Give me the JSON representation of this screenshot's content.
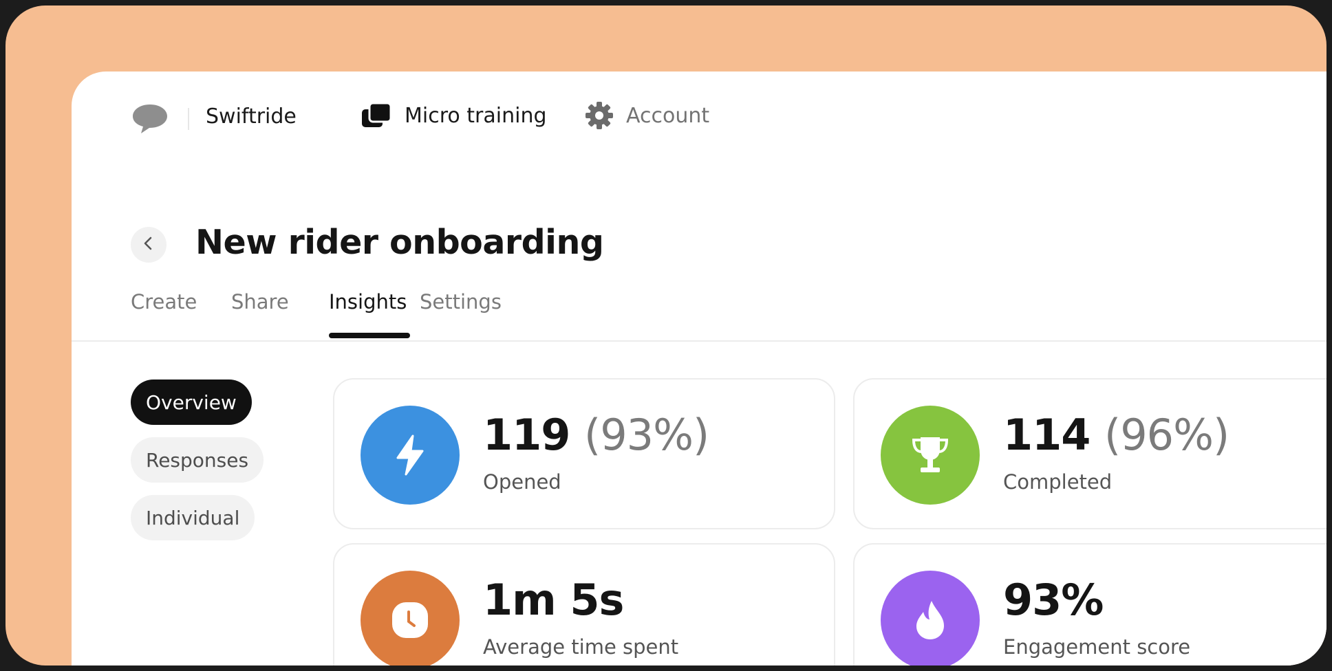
{
  "brand": {
    "name": "Swiftride",
    "icon": "speech-bubble-icon"
  },
  "nav": [
    {
      "label": "Micro training",
      "icon": "cards-stack-icon"
    },
    {
      "label": "Account",
      "icon": "gear-icon"
    }
  ],
  "page": {
    "title": "New rider onboarding",
    "back_icon": "chevron-left-icon"
  },
  "tabs": [
    {
      "label": "Create",
      "active": false
    },
    {
      "label": "Share",
      "active": false
    },
    {
      "label": "Insights",
      "active": true
    },
    {
      "label": "Settings",
      "active": false
    }
  ],
  "filters": [
    {
      "label": "Overview",
      "active": true
    },
    {
      "label": "Responses",
      "active": false
    },
    {
      "label": "Individual",
      "active": false
    }
  ],
  "stats": [
    {
      "value": "119",
      "percent": "(93%)",
      "label": "Opened",
      "icon": "lightning-icon",
      "color": "#3c91e0"
    },
    {
      "value": "114",
      "percent": "(96%)",
      "label": "Completed",
      "icon": "trophy-icon",
      "color": "#86c43f"
    },
    {
      "value": "1m 5s",
      "percent": "",
      "label": "Average time spent",
      "icon": "clock-icon",
      "color": "#dc7c3e"
    },
    {
      "value": "93%",
      "percent": "",
      "label": "Engagement score",
      "icon": "flame-icon",
      "color": "#9b63ef"
    }
  ],
  "colors": {
    "background": "#f6bd91",
    "surface": "#ffffff",
    "text": "#151515",
    "accent": "#111111"
  }
}
